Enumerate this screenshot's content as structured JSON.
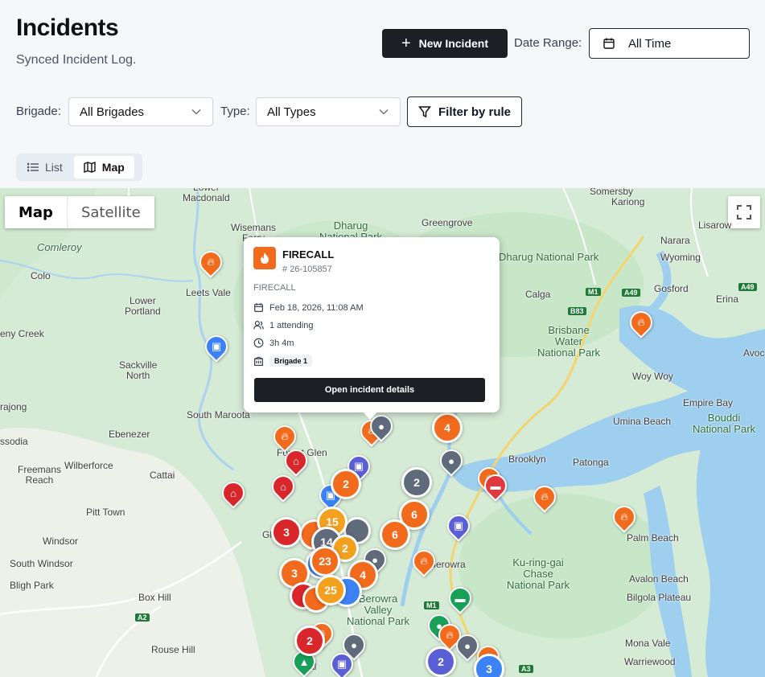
{
  "header": {
    "title": "Incidents",
    "subtitle": "Synced Incident Log.",
    "new_incident_label": "New Incident",
    "date_range_label": "Date Range:",
    "date_range_value": "All Time"
  },
  "filters": {
    "brigade_label": "Brigade:",
    "brigade_value": "All Brigades",
    "type_label": "Type:",
    "type_value": "All Types",
    "filter_rule_label": "Filter by rule"
  },
  "view_toggle": {
    "list_label": "List",
    "map_label": "Map",
    "active": "Map"
  },
  "map": {
    "type_map": "Map",
    "type_satellite": "Satellite",
    "places": {
      "lower_macdonald": "Lower\nMacdonald",
      "somersby": "Somersby",
      "wisemans_ferry": "Wisemans\nFerry",
      "dharug": "Dharug\nNational Park",
      "greengrove": "Greengrove",
      "kariong": "Kariong",
      "lisarow": "Lisarow",
      "comleroy": "Comleroy",
      "narara": "Narara",
      "wyoming": "Wyoming",
      "colo": "Colo",
      "leets_vale": "Leets Vale",
      "gosford": "Gosford",
      "calga": "Calga",
      "erina": "Erina",
      "lower_portland": "Lower\nPortland",
      "eny_creek": "eny Creek",
      "brisbane_water": "Brisbane\nWater\nNational Park",
      "avoca": "Avoc",
      "sackville_north": "Sackville\nNorth",
      "woy_woy": "Woy Woy",
      "empire_bay": "Empire Bay",
      "rajong": "rajong",
      "south_maroota": "South Maroota",
      "umina_beach": "Umina Beach",
      "bouddi": "Bouddi\nNational Park",
      "ssodia": "ssodia",
      "ebenezer": "Ebenezer",
      "forest_glen": "Forest Glen",
      "brooklyn": "Brooklyn",
      "patonga": "Patonga",
      "freemans_reach": "Freemans\nReach",
      "wilberforce": "Wilberforce",
      "cattai": "Cattai",
      "pitt_town": "Pitt Town",
      "palm_beach": "Palm Beach",
      "windsor": "Windsor",
      "south_windsor": "South Windsor",
      "kuringgai": "Ku-ring-gai\nChase\nNational Park",
      "bligh_park": "Bligh Park",
      "berowra": "Berowra",
      "avalon_beach": "Avalon Beach",
      "box_hill": "Box Hill",
      "berowra_valley": "Berowra\nValley\nNational Park",
      "bilgola": "Bilgola Plateau",
      "rouse_hill": "Rouse Hill",
      "mona_vale": "Mona Vale",
      "warriewood": "Warriewood",
      "glen_fragment": "Gl",
      "al_fragment": "al"
    },
    "shields": {
      "a49a": "A49",
      "a49b": "A49",
      "m1a": "M1",
      "b83": "B83",
      "m1b": "M1",
      "a2": "A2",
      "a3": "A3"
    },
    "clusters": {
      "c4a": "4",
      "c2a": "2",
      "c2b": "2",
      "c6a": "6",
      "c6b": "6",
      "c3a": "3",
      "c15": "15",
      "c14": "14",
      "c2c": "2",
      "c23": "23",
      "c3b": "3",
      "c4b": "4",
      "c25": "25",
      "c2d": "2",
      "c2e": "2",
      "c3c": "3"
    }
  },
  "popup": {
    "title": "FIRECALL",
    "number": "26-105857",
    "type": "FIRECALL",
    "datetime": "Feb 18, 2026, 11:08 AM",
    "attending": "1 attending",
    "duration": "3h 4m",
    "brigade": "Brigade 1",
    "button_label": "Open incident details"
  },
  "colors": {
    "fire": "#f26b1d",
    "red": "#d9262b",
    "blue": "#3b82f6",
    "purple": "#5b5fd6",
    "slate": "#5f6a7b",
    "green": "#18a058",
    "amber": "#f2a01d",
    "dark": "#1c1f24"
  }
}
